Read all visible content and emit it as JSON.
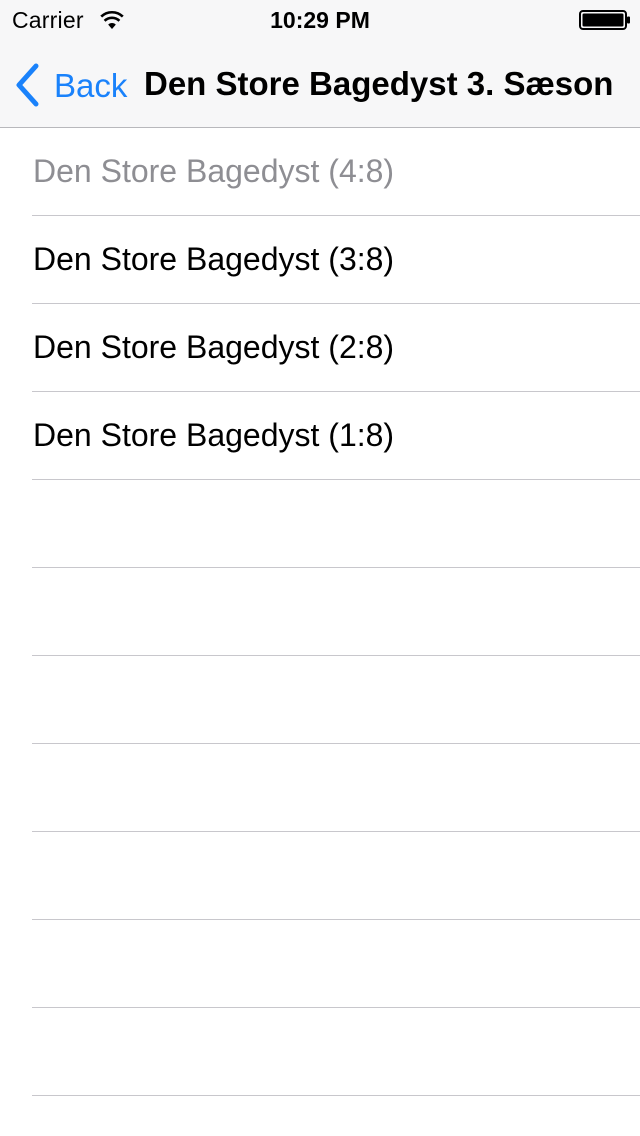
{
  "status_bar": {
    "carrier": "Carrier",
    "time": "10:29 PM",
    "wifi_icon": "wifi-icon",
    "battery_icon": "battery-icon"
  },
  "nav": {
    "back_label": "Back",
    "back_icon": "chevron-left-icon",
    "title": "Den Store Bagedyst 3. Sæson"
  },
  "colors": {
    "accent": "#1a82fb",
    "bar_background": "#f7f7f8",
    "separator": "#c8c7cc",
    "dimmed_text": "#8e8e93"
  },
  "episodes": [
    {
      "label": "Den Store Bagedyst (4:8)",
      "dimmed": true
    },
    {
      "label": "Den Store Bagedyst (3:8)",
      "dimmed": false
    },
    {
      "label": "Den Store Bagedyst (2:8)",
      "dimmed": false
    },
    {
      "label": "Den Store Bagedyst (1:8)",
      "dimmed": false
    },
    {
      "label": ""
    },
    {
      "label": ""
    },
    {
      "label": ""
    },
    {
      "label": ""
    },
    {
      "label": ""
    },
    {
      "label": ""
    },
    {
      "label": ""
    }
  ]
}
